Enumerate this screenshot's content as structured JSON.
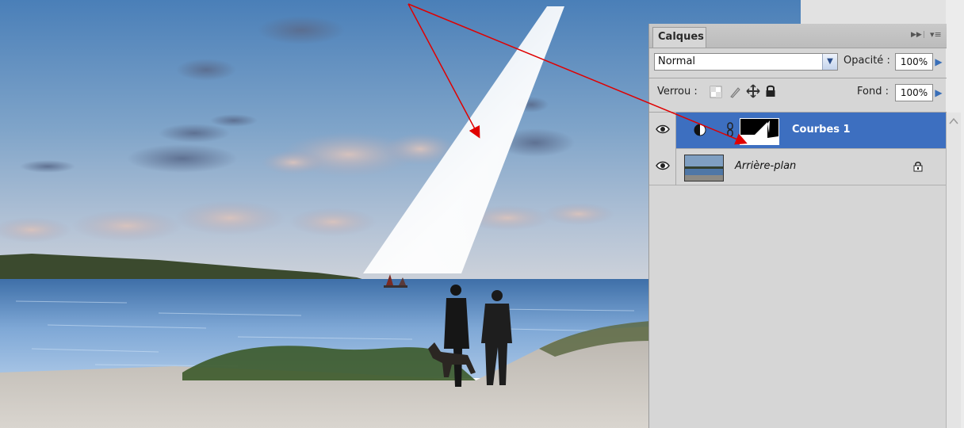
{
  "panel": {
    "tab_label": "Calques",
    "blend_mode": "Normal",
    "opacity_label": "Opacité :",
    "opacity_value": "100%",
    "lock_label": "Verrou :",
    "fill_label": "Fond :",
    "fill_value": "100%",
    "icons": {
      "expand": "double-chevron-right-icon",
      "menu": "panel-menu-icon",
      "visibility": "eye-icon",
      "adjustment": "adjustment-circle-icon",
      "link": "chain-link-icon",
      "lock": "padlock-icon"
    }
  },
  "layers": [
    {
      "name": "Courbes 1",
      "selected": true,
      "type": "curves-adjustment"
    },
    {
      "name": "Arrière-plan",
      "selected": false,
      "type": "background",
      "locked": true
    }
  ],
  "colors": {
    "selection": "#3d6fc0",
    "panel_bg": "#d6d6d6",
    "annotation_arrow": "#e00000"
  }
}
